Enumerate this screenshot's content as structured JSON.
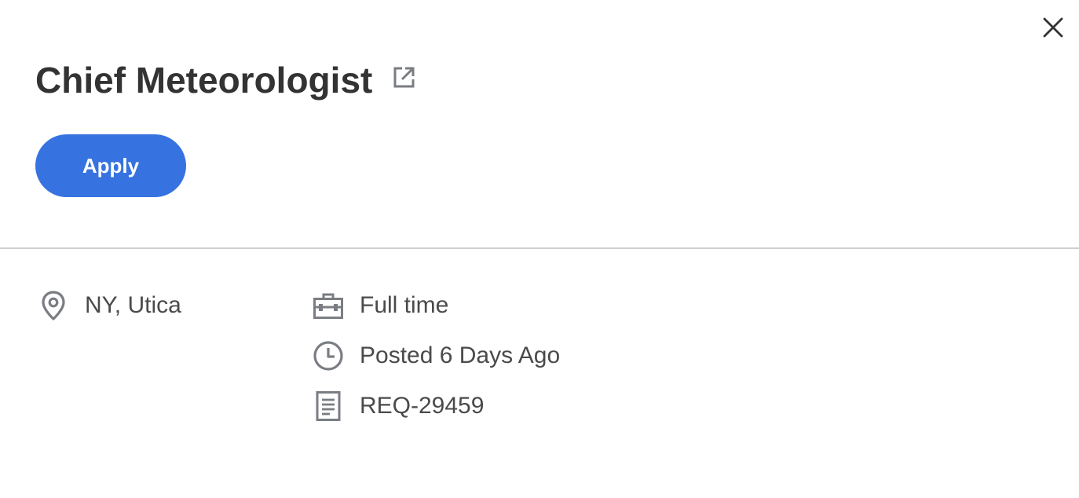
{
  "job": {
    "title": "Chief Meteorologist",
    "apply_label": "Apply",
    "location": "NY, Utica",
    "time_type": "Full time",
    "posted": "Posted 6 Days Ago",
    "requisition_id": "REQ-29459"
  },
  "icons": {
    "close": "close-icon",
    "external_link": "external-link-icon",
    "location": "location-pin-icon",
    "time_type": "briefcase-icon",
    "posted": "clock-icon",
    "requisition": "document-icon"
  },
  "colors": {
    "accent": "#3673e0",
    "title_text": "#333333",
    "meta_text": "#4a4a4a",
    "icon": "#7a7d82",
    "divider": "#cfcfcf"
  }
}
